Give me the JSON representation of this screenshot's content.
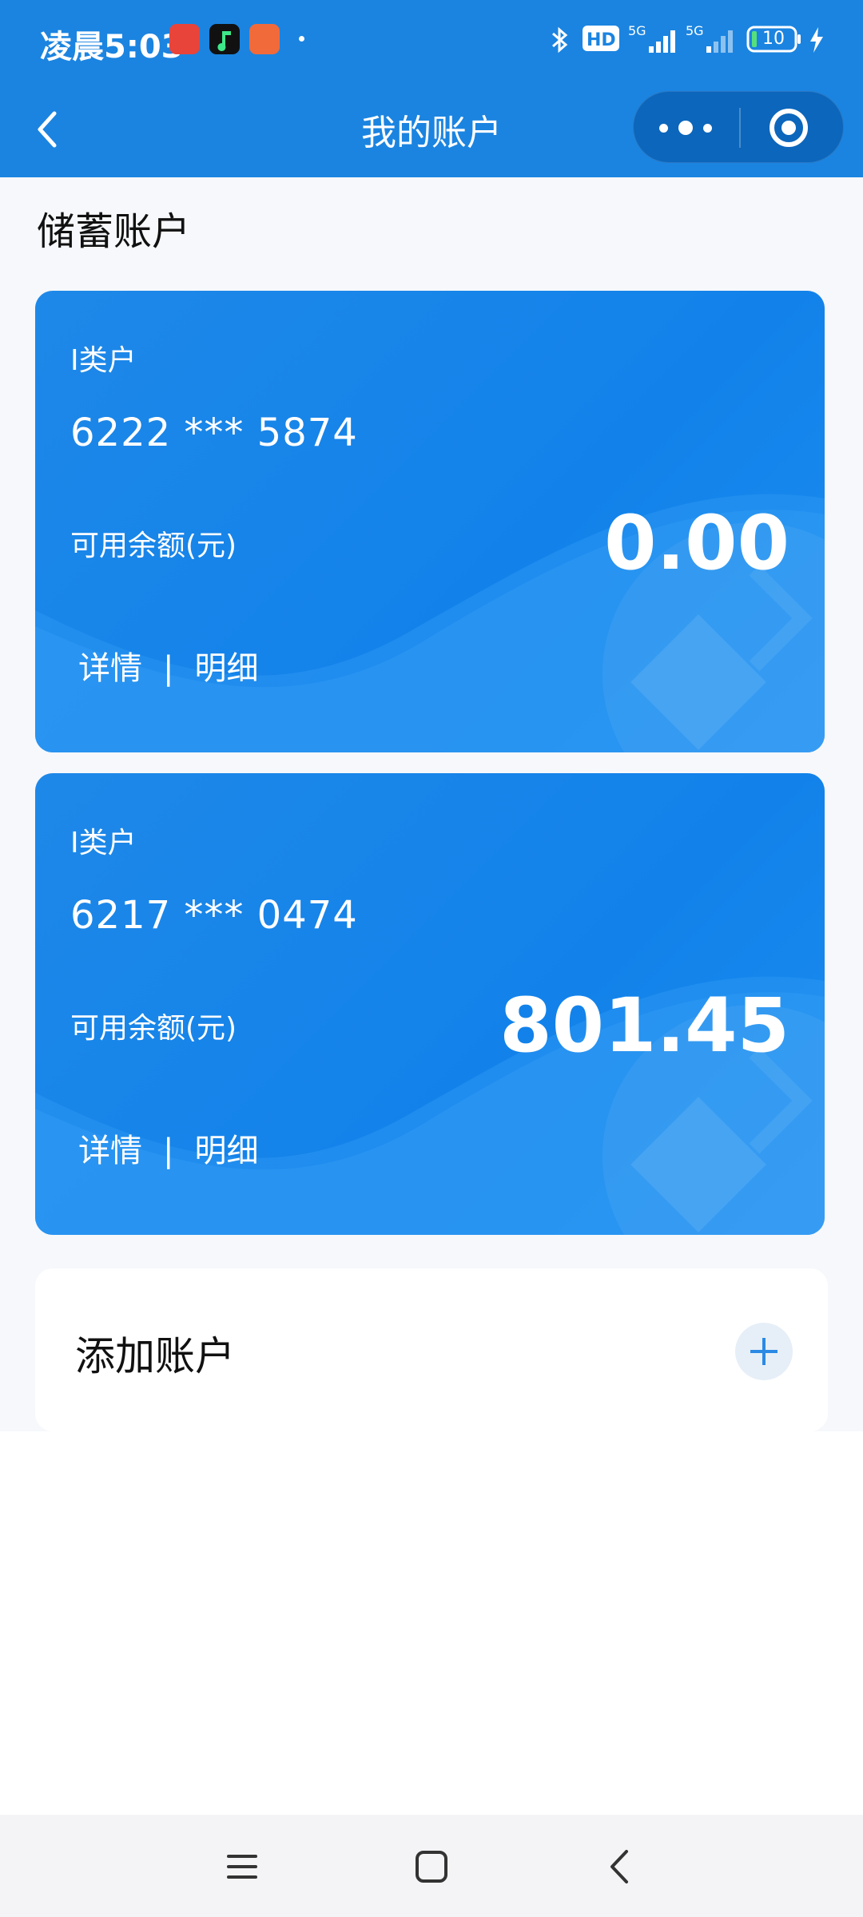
{
  "status_bar": {
    "time": "凌晨5:03",
    "icons": [
      "app-icon-red",
      "app-icon-music",
      "app-icon-shop",
      "notification-dot",
      "bluetooth-icon",
      "hd-icon",
      "signal-5g-icon",
      "signal-5g-icon",
      "battery-icon",
      "charging-icon"
    ],
    "battery_level": "10"
  },
  "nav": {
    "title": "我的账户",
    "back_icon": "chevron-left-icon",
    "menu_icon": "more-dots-icon",
    "close_icon": "target-circle-icon"
  },
  "section": {
    "title": "储蓄账户"
  },
  "accounts": [
    {
      "type": "Ⅰ类户",
      "number": "6222 *** 5874",
      "balance_label": "可用余额(元)",
      "balance": "0.00",
      "details_label": "详情",
      "separator": "|",
      "statement_label": "明细"
    },
    {
      "type": "Ⅰ类户",
      "number": "6217 *** 0474",
      "balance_label": "可用余额(元)",
      "balance": "801.45",
      "details_label": "详情",
      "separator": "|",
      "statement_label": "明细"
    }
  ],
  "add_account": {
    "label": "添加账户",
    "icon": "plus-icon"
  },
  "system_nav": {
    "icons": [
      "menu-icon",
      "home-icon",
      "back-icon"
    ]
  },
  "colors": {
    "brand": "#1b84e0",
    "card": "#1282ea",
    "background": "#f6f8fb"
  }
}
